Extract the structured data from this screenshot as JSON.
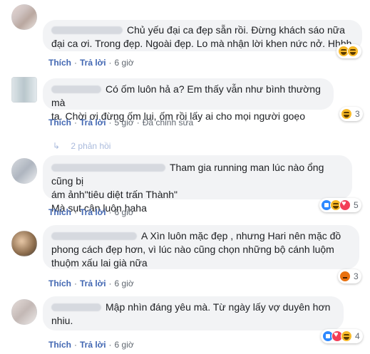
{
  "comments": [
    {
      "text": "Chủ yếu đại ca đẹp sẵn rồi. Đừng khách sáo nữa\nđại ca ơi. Trong đẹp. Ngoài đẹp. Lo mà nhận lời khen nức nở. Hhhh",
      "actions": {
        "like": "Thích",
        "reply": "Trả lời",
        "time": "6 giờ"
      },
      "reactions": {
        "icons": [
          "haha-icon",
          "haha-icon"
        ],
        "count": ""
      }
    },
    {
      "text": "Có ốm luôn hả a? Em thấy vẫn như bình thường mà\nta. Chời ơi đừng ốm lui, ốm rồi lấy ai cho mọi người goẹo",
      "actions": {
        "like": "Thích",
        "reply": "Trả lời",
        "time": "5 giờ",
        "edited": "Đã chỉnh sửa"
      },
      "reactions": {
        "icons": [
          "haha-icon"
        ],
        "count": "3"
      },
      "replies_label": "2 phản hồi"
    },
    {
      "text": "Tham gia running man lúc nào ổng cũng bị\nám ảnh\"tiêu diệt trấn Thành\"\nMà sụt cân luôn haha",
      "actions": {
        "like": "Thích",
        "reply": "Trả lời",
        "time": "6 giờ"
      },
      "reactions": {
        "icons": [
          "like-icon",
          "haha-icon",
          "love-icon"
        ],
        "count": "5"
      }
    },
    {
      "text": "A Xìn luôn mặc đẹp , nhưng Hari nên mặc đồ\nphong cách đẹp hơn, vì lúc nào cũng chọn những bộ cánh luộm\nthuộm xấu lai già nữa",
      "actions": {
        "like": "Thích",
        "reply": "Trả lời",
        "time": "6 giờ"
      },
      "reactions": {
        "icons": [
          "angry-icon"
        ],
        "count": "3"
      }
    },
    {
      "text": "Mập nhìn đáng yêu mà. Từ ngày lấy vợ duyên hơn\nnhiu.",
      "actions": {
        "like": "Thích",
        "reply": "Trả lời",
        "time": "6 giờ"
      },
      "reactions": {
        "icons": [
          "like-icon",
          "love-icon",
          "haha-icon"
        ],
        "count": "4"
      }
    }
  ]
}
